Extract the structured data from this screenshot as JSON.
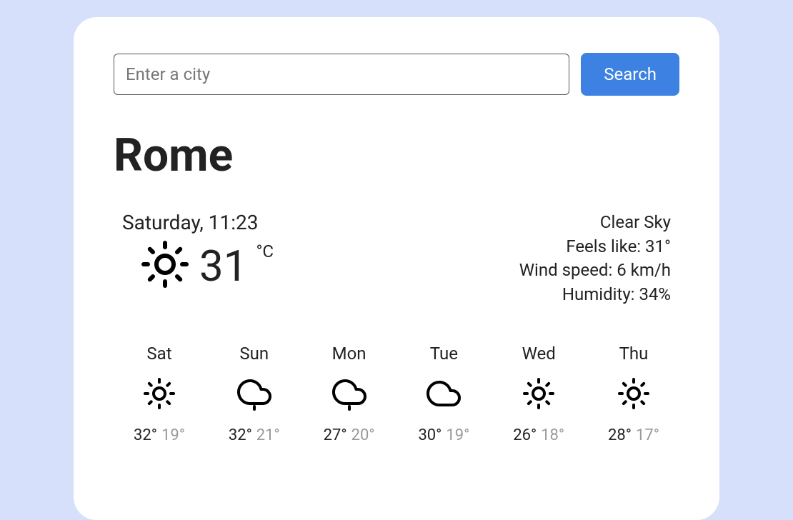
{
  "search": {
    "placeholder": "Enter a city",
    "button_label": "Search"
  },
  "city": "Rome",
  "current": {
    "date_time": "Saturday, 11:23",
    "temperature": "31",
    "unit": "°C",
    "icon": "sun",
    "condition": "Clear Sky",
    "feels_like": "Feels like: 31°",
    "wind": "Wind speed: 6 km/h",
    "humidity": "Humidity: 34%"
  },
  "forecast": [
    {
      "day": "Sat",
      "icon": "sun",
      "high": "32°",
      "low": "19°"
    },
    {
      "day": "Sun",
      "icon": "rain",
      "high": "32°",
      "low": "21°"
    },
    {
      "day": "Mon",
      "icon": "rain",
      "high": "27°",
      "low": "20°"
    },
    {
      "day": "Tue",
      "icon": "cloud",
      "high": "30°",
      "low": "19°"
    },
    {
      "day": "Wed",
      "icon": "sun",
      "high": "26°",
      "low": "18°"
    },
    {
      "day": "Thu",
      "icon": "sun",
      "high": "28°",
      "low": "17°"
    }
  ]
}
